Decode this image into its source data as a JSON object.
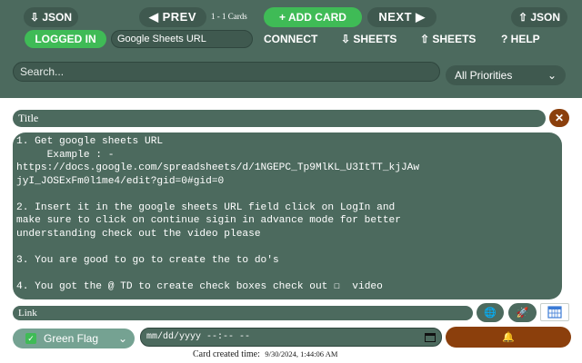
{
  "toolbar": {
    "json_left": "⇩ JSON",
    "prev": "◀ PREV",
    "cards_count": "1 - 1 Cards",
    "add_card": "+ ADD CARD",
    "next": "NEXT ▶",
    "json_right": "⇧ JSON"
  },
  "nav": {
    "logged_in": "LOGGED IN",
    "sheets_url_value": "Google Sheets URL",
    "connect": "CONNECT",
    "sheets_down": "⇩ SHEETS",
    "sheets_up": "⇧ SHEETS",
    "help": "? HELP"
  },
  "filter": {
    "search_placeholder": "Search...",
    "priority_selected": "All Priorities"
  },
  "card": {
    "title_placeholder": "Title",
    "content": "1. Get google sheets URL\n     Example : -\nhttps://docs.google.com/spreadsheets/d/1NGEPC_Tp9MlKL_U3ItTT_kjJAw\njyI_JOSExFm0l1me4/edit?gid=0#gid=0\n\n2. Insert it in the google sheets URL field click on LogIn and\nmake sure to click on continue sigin in advance mode for better\nunderstanding check out the video please\n\n3. You are good to go to create the to do's\n\n4. You got the @ TD to create check boxes check out ☐  video",
    "link_placeholder": "Link",
    "flag_selected": "Green Flag",
    "datetime_placeholder": "mm/dd/yyyy --:-- --",
    "created_label": "Card created time:",
    "created_value": "9/30/2024, 1:44:06 AM"
  },
  "icons": {
    "close": "✕",
    "globe": "🌐",
    "rocket": "🚀",
    "bell": "🔔",
    "chevron": "⌄",
    "calendar": "📅"
  },
  "colors": {
    "bar": "#4c6a5e",
    "accent_green": "#3fbb56",
    "accent_brown": "#8b3f0c"
  }
}
